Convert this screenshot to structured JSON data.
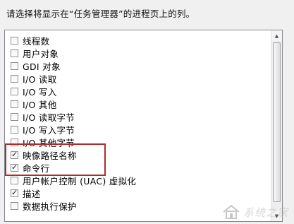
{
  "instruction": "请选择将显示在“任务管理器”的进程页上的列。",
  "columns": [
    {
      "label": "线程数",
      "checked": false
    },
    {
      "label": "用户对象",
      "checked": false
    },
    {
      "label": "GDI 对象",
      "checked": false
    },
    {
      "label": "I/O 读取",
      "checked": false
    },
    {
      "label": "I/O 写入",
      "checked": false
    },
    {
      "label": "I/O 其他",
      "checked": false
    },
    {
      "label": "I/O 读取字节",
      "checked": false
    },
    {
      "label": "I/O 写入字节",
      "checked": false
    },
    {
      "label": "I/O 其他字节",
      "checked": false
    },
    {
      "label": "映像路径名称",
      "checked": true
    },
    {
      "label": "命令行",
      "checked": true
    },
    {
      "label": "用户帐户控制 (UAC) 虚拟化",
      "checked": false
    },
    {
      "label": "描述",
      "checked": true
    },
    {
      "label": "数据执行保护",
      "checked": false
    }
  ],
  "watermark": {
    "text": "系统之家"
  },
  "colors": {
    "highlight": "#b02c2c"
  }
}
